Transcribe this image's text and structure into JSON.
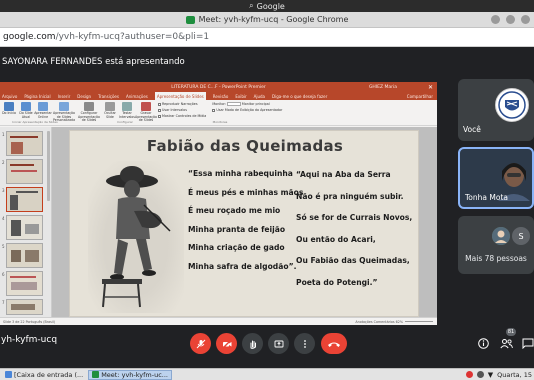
{
  "os": {
    "top_title": "Google"
  },
  "window": {
    "title": "Meet: yvh-kyfm-ucq - Google Chrome"
  },
  "address_bar": {
    "domain": "google.com",
    "path": "/yvh-kyfm-ucq?authuser=0&pli=1"
  },
  "meet": {
    "presenter_text": "SAYONARA FERNANDES está apresentando",
    "meeting_code": "yh-kyfm-ucq",
    "participants_badge": "81",
    "participants": [
      {
        "label": "Você"
      },
      {
        "label": "Tonha Mota"
      }
    ],
    "more_label": "Mais 78 pessoas",
    "more_avatar_letter": "S"
  },
  "powerpoint": {
    "window_title": "LITERATURA DE C...F  -  PowerPoint  Premier",
    "user_label": "GHIEZ Maria",
    "tabs": [
      "Arquivo",
      "Página Inicial",
      "Inserir",
      "Design",
      "Transições",
      "Animações",
      "Apresentação de Slides",
      "Revisão",
      "Exibir",
      "Ajuda",
      "Diga-me o que deseja fazer"
    ],
    "active_tab": "Apresentação de Slides",
    "share_label": "Compartilhar",
    "ribbon_buttons": [
      "Do Início",
      "Do Slide Atual",
      "Apresentar Online",
      "Apresentação de Slides Personalizada",
      "Configurar Apresentação de Slides",
      "Ocultar Slide",
      "Testar Intervalos",
      "Gravar Apresentação de Slides"
    ],
    "checkboxes": [
      "Reproduzir Narrações",
      "Usar Intervalos",
      "Mostrar Controles de Mídia"
    ],
    "monitor_label": "Monitor:",
    "monitor_value": "Monitor principal",
    "presenter_view": "Usar Modo de Exibição do Apresentador",
    "groups": [
      "Iniciar Apresentação de Slides",
      "Configurar",
      "Monitores"
    ],
    "thumbnails": [
      "1",
      "2",
      "3",
      "4",
      "5",
      "6",
      "7"
    ],
    "status_left": "Slide 3 de 22   Português (Brasil)",
    "status_right": "Anotações   Comentários   62%"
  },
  "slide": {
    "title": "Fabião das Queimadas",
    "left_verses": [
      "“Essa minha rabequinha",
      "É meus pés e minhas mãos",
      "É meu roçado me mio",
      "Minha pranta de feijão",
      "Minha criação de gado",
      "Minha safra de algodão”."
    ],
    "right_verses": [
      "“Aqui na Aba da Serra",
      "Não é pra ninguém subir.",
      "Só se for de Currais Novos,",
      "Ou então do Acari,",
      "Ou Fabião das Queimadas,",
      "Poeta do Potengi.”"
    ]
  },
  "taskbar": {
    "items": [
      {
        "label": "[Caixa de entrada (..."
      },
      {
        "label": "Meet: yvh-kyfm-uc..."
      }
    ],
    "clock": "Quarta, 15"
  },
  "colors": {
    "accent": "#b7472a",
    "meet_bg": "#202124",
    "hangup": "#ea4335",
    "selected_tile": "#8ab4f8"
  }
}
